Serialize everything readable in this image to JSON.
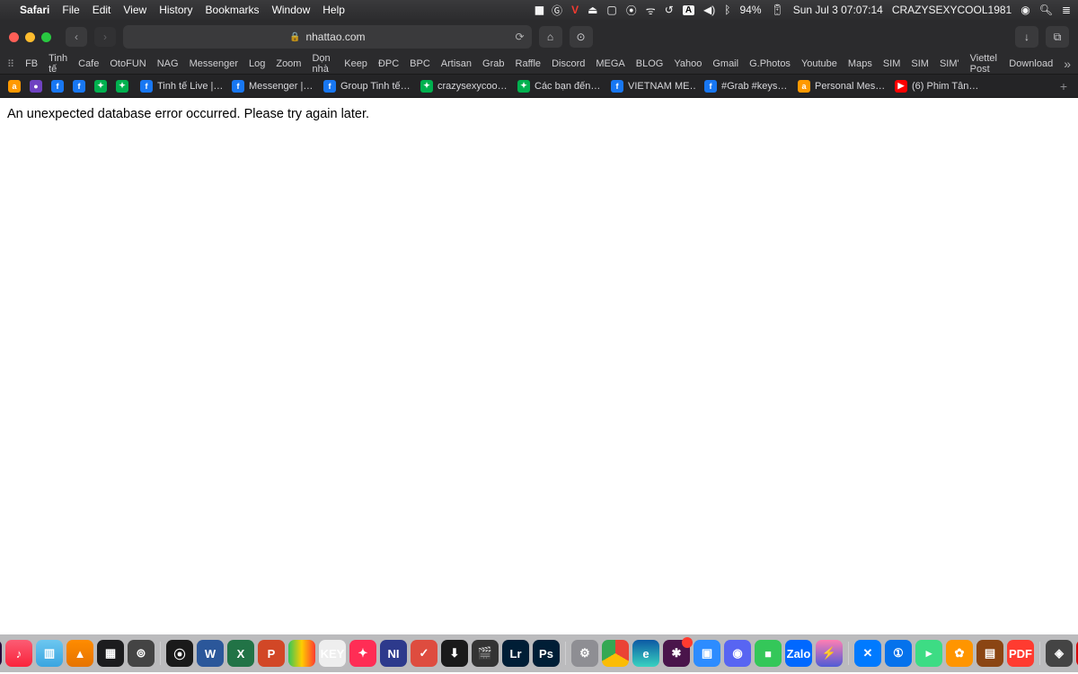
{
  "menubar": {
    "app": "Safari",
    "items": [
      "File",
      "Edit",
      "View",
      "History",
      "Bookmarks",
      "Window",
      "Help"
    ],
    "battery": "94%",
    "datetime": "Sun Jul 3  07:07:14",
    "user": "CRAZYSEXYCOOL1981"
  },
  "addr": {
    "url": "nhattao.com"
  },
  "favorites": [
    "FB",
    "Tinh tế",
    "Cafe",
    "OtoFUN",
    "NAG",
    "Messenger",
    "Log",
    "Zoom",
    "Dọn nhà",
    "Keep",
    "ĐPC",
    "BPC",
    "Artisan",
    "Grab",
    "Raffle",
    "Discord",
    "MEGA",
    "BLOG",
    "Yahoo",
    "Gmail",
    "G.Photos",
    "Youtube",
    "Maps",
    "SIM",
    "SIM",
    "SIM'",
    "Viettel Post",
    "Download"
  ],
  "bookmarks": [
    {
      "icon": "az",
      "label": ""
    },
    {
      "icon": "pp",
      "label": ""
    },
    {
      "icon": "fb",
      "label": ""
    },
    {
      "icon": "fb",
      "label": ""
    },
    {
      "icon": "grab",
      "label": ""
    },
    {
      "icon": "grab",
      "label": ""
    },
    {
      "icon": "fb",
      "label": "Tinh tế Live |…"
    },
    {
      "icon": "fb",
      "label": "Messenger |…"
    },
    {
      "icon": "fb",
      "label": "Group Tinh tế…"
    },
    {
      "icon": "grab",
      "label": "crazysexycoo…"
    },
    {
      "icon": "grab",
      "label": "Các bạn đến…"
    },
    {
      "icon": "fb",
      "label": "VIETNAM ME…"
    },
    {
      "icon": "fb",
      "label": "#Grab #keys…"
    },
    {
      "icon": "az",
      "label": "Personal Mes…"
    },
    {
      "icon": "yt",
      "label": "(6) Phim Tân…"
    }
  ],
  "page": {
    "error": "An unexpected database error occurred. Please try again later."
  },
  "dock": {
    "badge_doc": "3",
    "key_label": "KEY",
    "zalo_label": "Zalo",
    "pdf_label": "PDF"
  }
}
